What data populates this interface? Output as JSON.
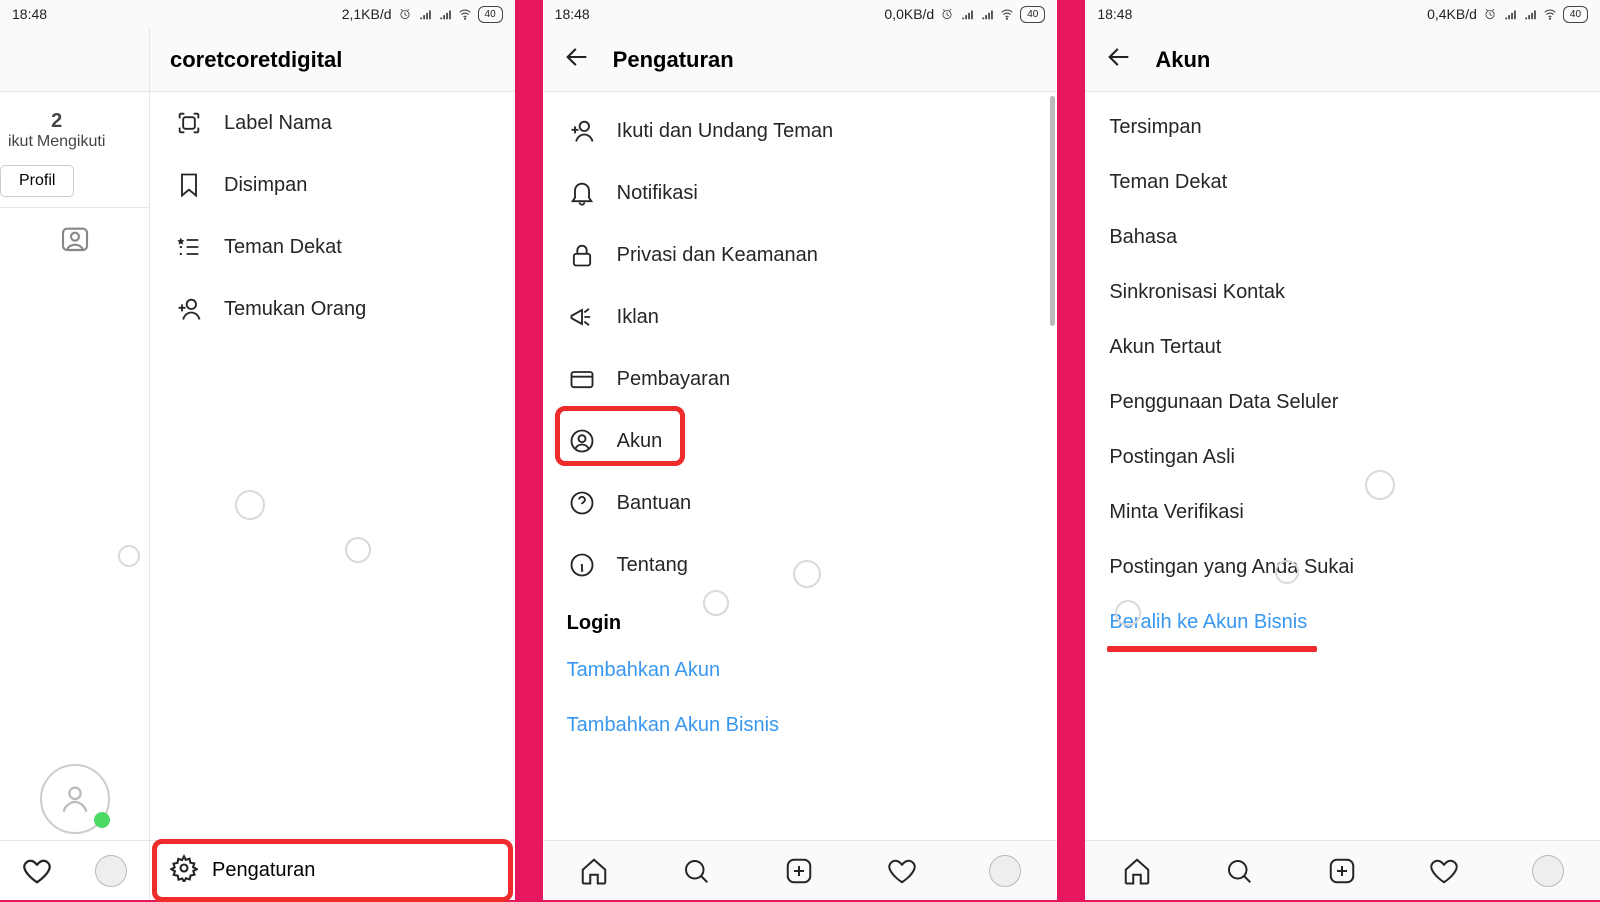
{
  "status": {
    "time": "18:48",
    "battery": "40",
    "speed1": "2,1KB/d",
    "speed2": "0,0KB/d",
    "speed3": "0,4KB/d"
  },
  "screen1": {
    "username": "coretcoretdigital",
    "following_count": "2",
    "pengikut_label": "ikut",
    "mengikuti_label": "Mengikuti",
    "edit_profile": "Profil",
    "drawer": {
      "label_nama": "Label Nama",
      "disimpan": "Disimpan",
      "teman_dekat": "Teman Dekat",
      "temukan_orang": "Temukan Orang",
      "pengaturan": "Pengaturan"
    }
  },
  "screen2": {
    "title": "Pengaturan",
    "items": {
      "ikuti": "Ikuti dan Undang Teman",
      "notifikasi": "Notifikasi",
      "privasi": "Privasi dan Keamanan",
      "iklan": "Iklan",
      "pembayaran": "Pembayaran",
      "akun": "Akun",
      "bantuan": "Bantuan",
      "tentang": "Tentang"
    },
    "login_section": "Login",
    "tambahkan_akun": "Tambahkan Akun",
    "tambahkan_bisnis": "Tambahkan Akun Bisnis"
  },
  "screen3": {
    "title": "Akun",
    "items": {
      "tersimpan": "Tersimpan",
      "teman_dekat": "Teman Dekat",
      "bahasa": "Bahasa",
      "sinkron": "Sinkronisasi Kontak",
      "tertaut": "Akun Tertaut",
      "data_seluler": "Penggunaan Data Seluler",
      "postingan_asli": "Postingan Asli",
      "minta_verif": "Minta Verifikasi",
      "postingan_suka": "Postingan yang Anda Sukai",
      "beralih_bisnis": "Beralih ke Akun Bisnis"
    }
  }
}
